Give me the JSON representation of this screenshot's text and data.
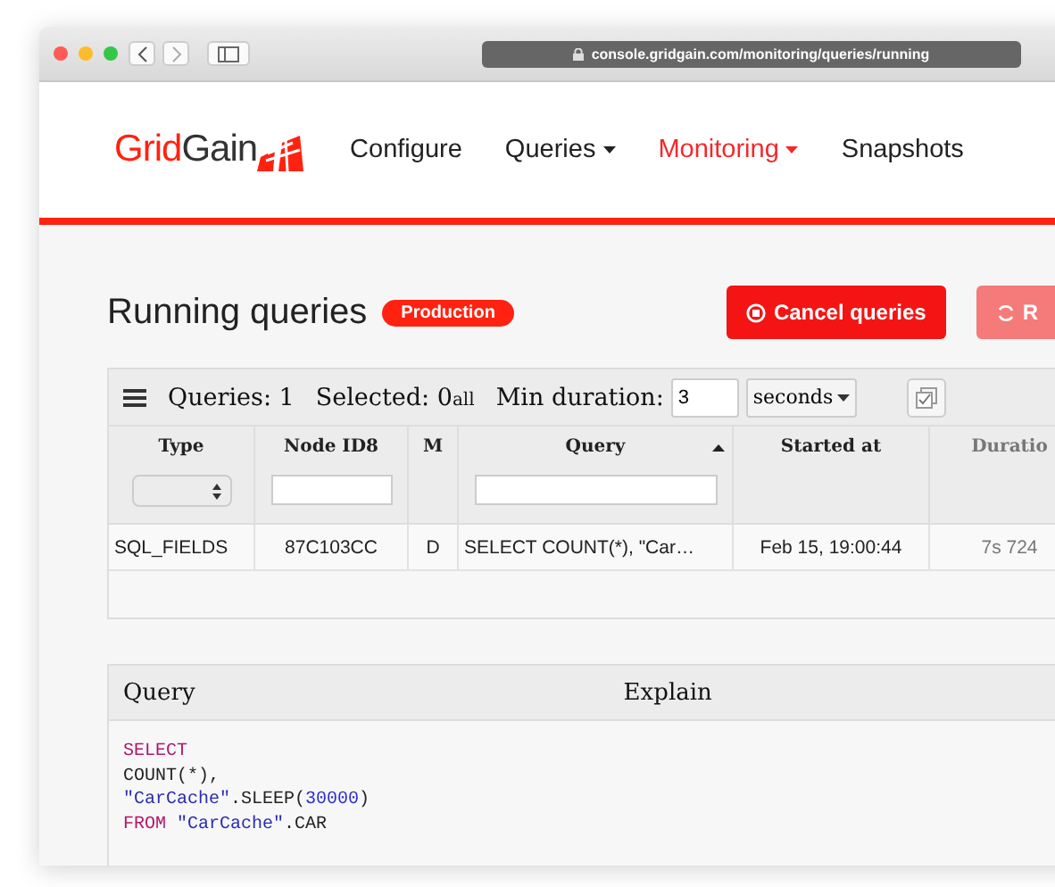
{
  "browser": {
    "url": "console.gridgain.com/monitoring/queries/running"
  },
  "brand": {
    "name_red": "Grid",
    "name_dark": "Gain"
  },
  "nav": [
    {
      "label": "Configure",
      "has_menu": false,
      "selected": false
    },
    {
      "label": "Queries",
      "has_menu": true,
      "selected": false
    },
    {
      "label": "Monitoring",
      "has_menu": true,
      "selected": true
    },
    {
      "label": "Snapshots",
      "has_menu": false,
      "selected": false
    }
  ],
  "page_title": "Running queries",
  "badge": "Production",
  "actions": [
    {
      "label": "Cancel queries",
      "kind": "cancel",
      "disabled": false
    },
    {
      "label": "R",
      "kind": "refresh",
      "disabled": true
    }
  ],
  "toolbar": {
    "queries_label": "Queries:",
    "queries_count": "1",
    "selected_label": "Selected:",
    "selected_count": "0",
    "selected_suffix": "all",
    "min_duration_label": "Min duration:",
    "min_duration_value": "3",
    "unit": "seconds"
  },
  "table": {
    "columns": [
      {
        "label": "Type",
        "kind": "select",
        "sorted": false
      },
      {
        "label": "Node ID8",
        "kind": "text",
        "sorted": false
      },
      {
        "label": "M",
        "kind": "plain",
        "sorted": false
      },
      {
        "label": "Query",
        "kind": "text",
        "sorted": true
      },
      {
        "label": "Started at",
        "kind": "plain",
        "sorted": false
      },
      {
        "label": "Duratio",
        "kind": "plain",
        "sorted": false
      }
    ],
    "rows": [
      [
        "SQL_FIELDS",
        "87C103CC",
        "D",
        "SELECT COUNT(*), \"Car…",
        "Feb 15, 19:00:44",
        "7s 724"
      ]
    ]
  },
  "detail": {
    "query_heading": "Query",
    "explain_heading": "Explain",
    "code": [
      [
        {
          "kind": "keyword",
          "text": "SELECT"
        }
      ],
      [
        {
          "kind": "plain",
          "text": "COUNT(*),"
        }
      ],
      [
        {
          "kind": "string",
          "text": "\"CarCache\""
        },
        {
          "kind": "plain",
          "text": ".SLEEP("
        },
        {
          "kind": "number",
          "text": "30000"
        },
        {
          "kind": "plain",
          "text": ")"
        }
      ],
      [
        {
          "kind": "keyword",
          "text": "FROM"
        },
        {
          "kind": "string",
          "text": "\"CarCache\""
        },
        {
          "kind": "plain",
          "text": ".CAR"
        }
      ]
    ]
  }
}
